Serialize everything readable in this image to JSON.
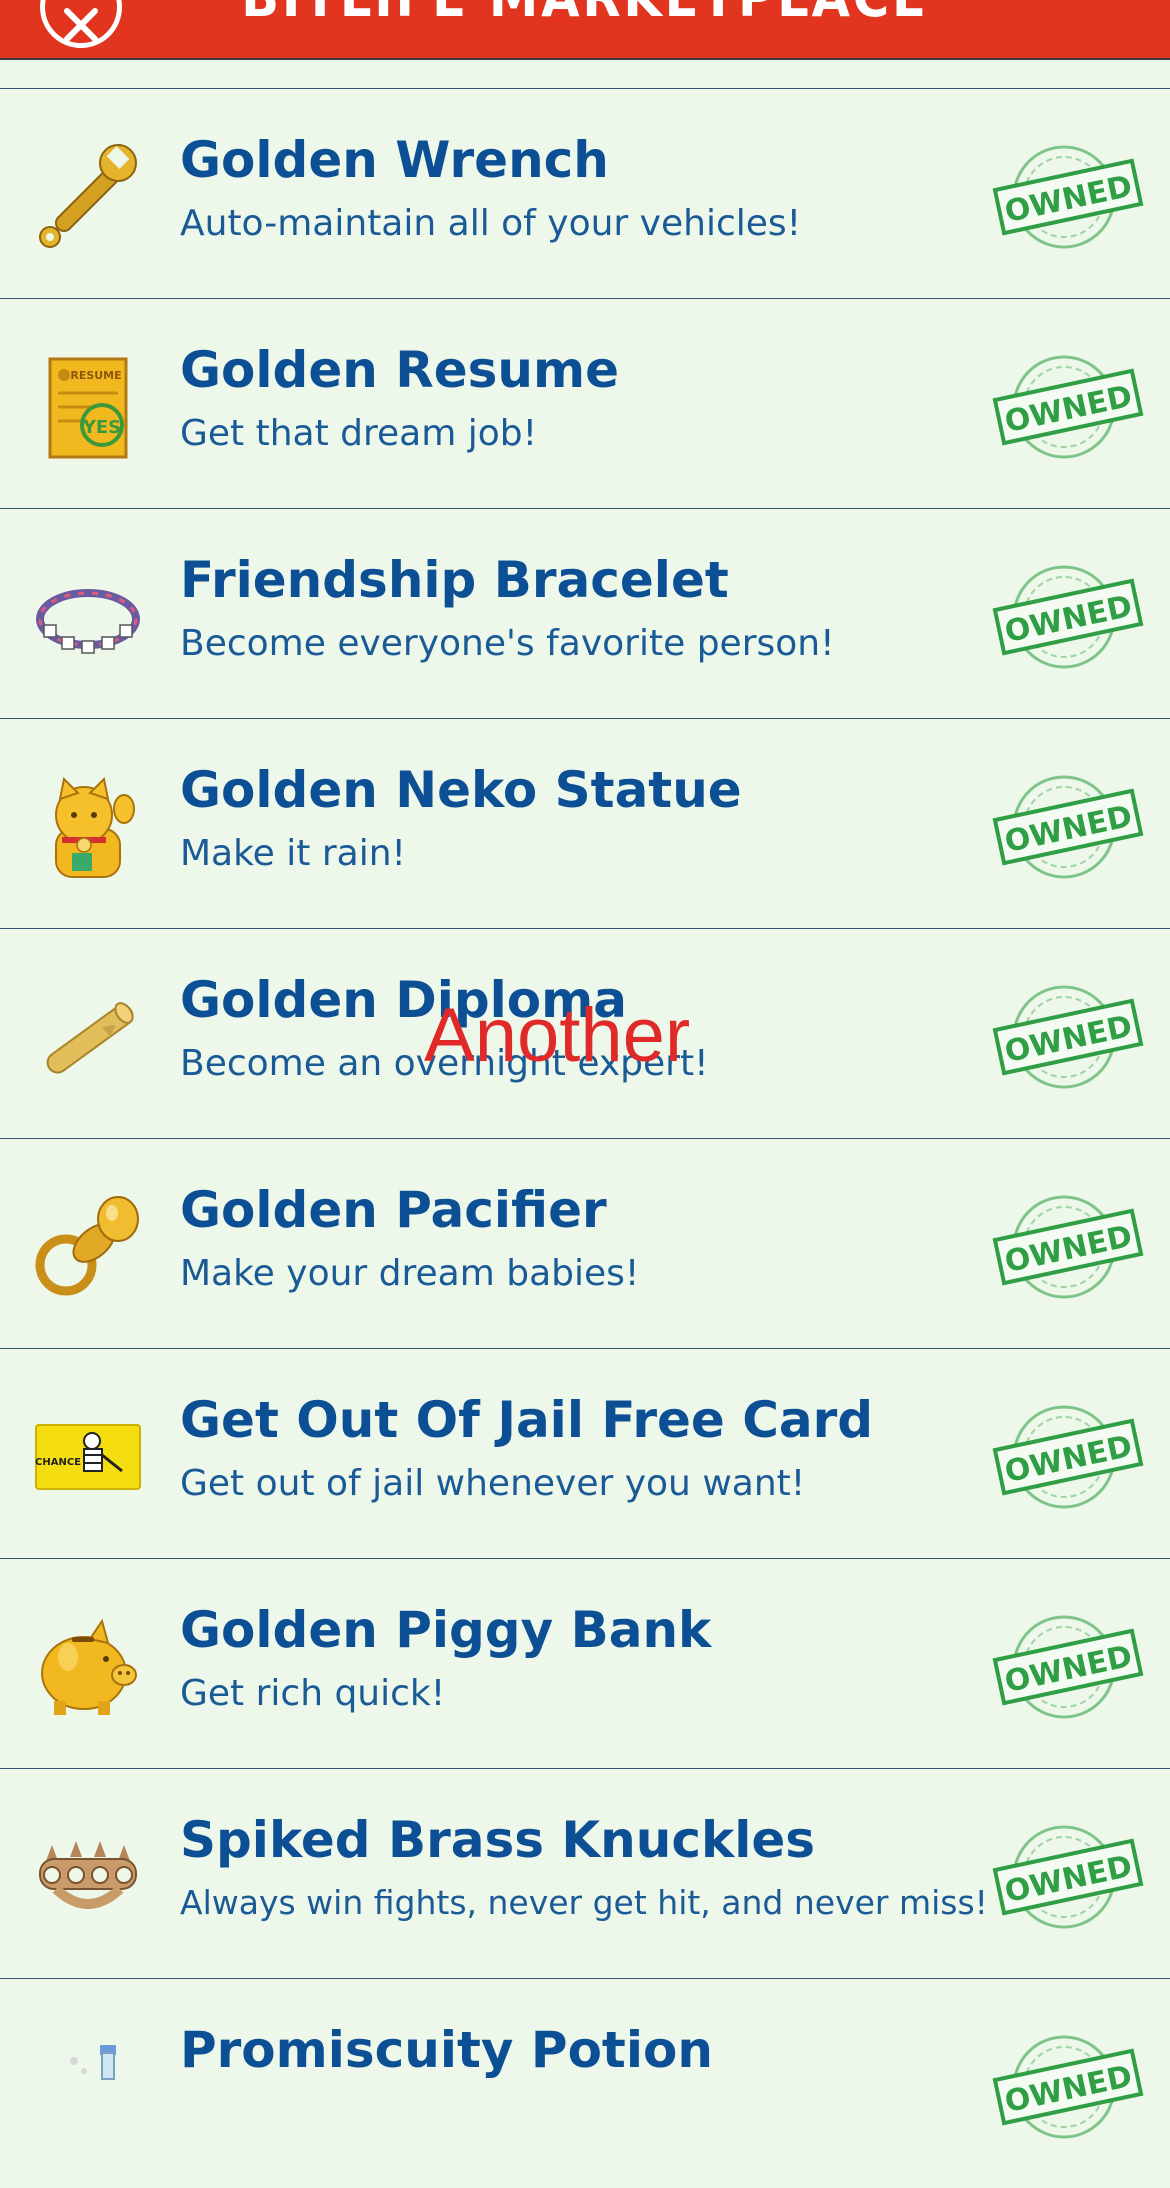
{
  "header": {
    "title": "BITLIFE MARKETPLACE",
    "close_icon": "close-icon"
  },
  "colors": {
    "header_bg": "#e2351f",
    "title_color": "#0d4f94",
    "owned_green": "#2f9e44",
    "overlay_red": "#e02a2a"
  },
  "items": [
    {
      "title": "Golden Wrench",
      "desc": "Auto-maintain all of your vehicles!",
      "icon": "wrench-icon",
      "status": "OWNED"
    },
    {
      "title": "Golden Resume",
      "desc": "Get that dream job!",
      "icon": "resume-icon",
      "status": "OWNED"
    },
    {
      "title": "Friendship Bracelet",
      "desc": "Become everyone's favorite person!",
      "icon": "bracelet-icon",
      "status": "OWNED"
    },
    {
      "title": "Golden Neko Statue",
      "desc": "Make it rain!",
      "icon": "neko-cat-icon",
      "status": "OWNED"
    },
    {
      "title": "Golden Diploma",
      "desc": "Become an overnight expert!",
      "icon": "diploma-icon",
      "status": "OWNED"
    },
    {
      "title": "Golden Pacifier",
      "desc": "Make your dream babies!",
      "icon": "pacifier-icon",
      "status": "OWNED"
    },
    {
      "title": "Get Out Of Jail Free Card",
      "desc": "Get out of jail whenever you want!",
      "icon": "jail-card-icon",
      "status": "OWNED"
    },
    {
      "title": "Golden Piggy Bank",
      "desc": "Get rich quick!",
      "icon": "piggy-bank-icon",
      "status": "OWNED"
    },
    {
      "title": "Spiked Brass Knuckles",
      "desc": "Always win fights, never get hit, and never miss!",
      "icon": "brass-knuckles-icon",
      "status": "OWNED"
    },
    {
      "title": "Promiscuity Potion",
      "desc": "",
      "icon": "potion-icon",
      "status": "OWNED"
    }
  ],
  "icon_texts": {
    "resume": "RESUME",
    "yes": "YES",
    "chance": "CHANCE"
  },
  "overlay_text": "Another"
}
